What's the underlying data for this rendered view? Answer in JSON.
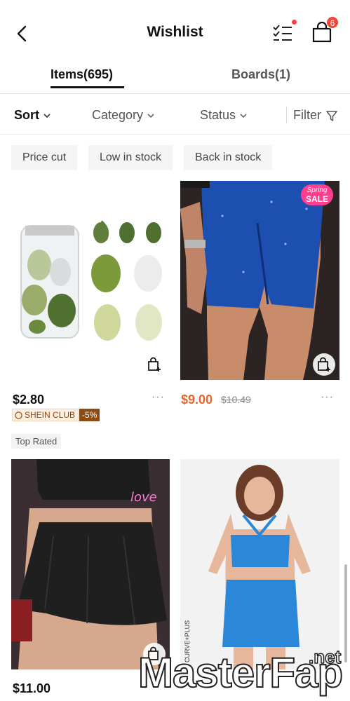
{
  "header": {
    "title": "Wishlist",
    "cart_count": "6"
  },
  "tabs": [
    {
      "label": "Items(695)"
    },
    {
      "label": "Boards(1)"
    }
  ],
  "filters": {
    "sort": "Sort",
    "category": "Category",
    "status": "Status",
    "filter": "Filter"
  },
  "chips": [
    "Price cut",
    "Low in stock",
    "Back in stock"
  ],
  "products": [
    {
      "image": "makeup-sponge-set",
      "price": "$2.80",
      "club_label": "SHEIN CLUB",
      "club_discount": "-5%",
      "tag": "Top Rated",
      "more": "···"
    },
    {
      "image": "blue-sequin-skort",
      "price": "$9.00",
      "original_price": "$10.49",
      "badge_line1": "Spring",
      "badge_line2": "SALE",
      "more": "···"
    },
    {
      "image": "black-skater-skirt",
      "price": "$11.00"
    },
    {
      "image": "blue-halter-crop-set",
      "side_label": "CURVE+PLUS"
    }
  ],
  "watermark": {
    "text": "MasterFap",
    "suffix": ".net"
  },
  "colors": {
    "accent": "#e5652e",
    "badge_red": "#f0463c",
    "club_brown": "#8a4b14"
  }
}
